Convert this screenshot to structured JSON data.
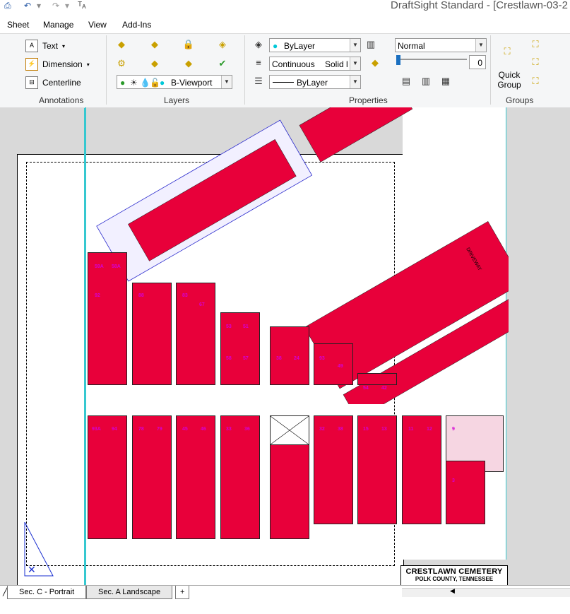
{
  "window": {
    "title": "DraftSight Standard - [Crestlawn-03-2",
    "quick_access": [
      "print-icon",
      "undo-icon",
      "redo-icon",
      "text-style-icon"
    ]
  },
  "menu": [
    "Sheet",
    "Manage",
    "View",
    "Add-Ins"
  ],
  "ribbon": {
    "annotations": {
      "label": "Annotations",
      "items": [
        {
          "label": "Text",
          "icon": "text-icon"
        },
        {
          "label": "Dimension",
          "icon": "dimension-icon"
        },
        {
          "label": "Centerline",
          "icon": "centerline-icon"
        }
      ]
    },
    "layers": {
      "label": "Layers",
      "current_layer": "B-Viewport"
    },
    "properties": {
      "label": "Properties",
      "color": "ByLayer",
      "linetype": "Continuous",
      "linetype_desc": "Solid l",
      "lineweight": "ByLayer",
      "transparency_mode": "Normal",
      "transparency_value": "0"
    },
    "groups": {
      "label": "Groups",
      "quick_group": "Quick Group"
    }
  },
  "drawing": {
    "driveway_label": "DRIVEWAY",
    "title_block": {
      "name": "CRESTLAWN CEMETERY",
      "county": "POLK COUNTY, TENNESSEE"
    },
    "lot_color": "#e8003a",
    "label_color": "#d400d4",
    "lot_numbers": [
      "59A",
      "58A",
      "92",
      "88",
      "83",
      "67",
      "53",
      "51",
      "58",
      "57",
      "38",
      "24",
      "93",
      "49",
      "54",
      "42",
      "30",
      "16",
      "93A",
      "94",
      "78",
      "79",
      "45",
      "46",
      "33",
      "36",
      "32",
      "38",
      "15",
      "13",
      "11",
      "12",
      "9",
      "5",
      "59B",
      "24B",
      "56",
      "40",
      "34",
      "27",
      "22",
      "21",
      "20",
      "17",
      "14",
      "8",
      "4",
      "3"
    ]
  },
  "tabs": [
    "Sec. C - Portrait",
    "Sec. A Landscape"
  ]
}
